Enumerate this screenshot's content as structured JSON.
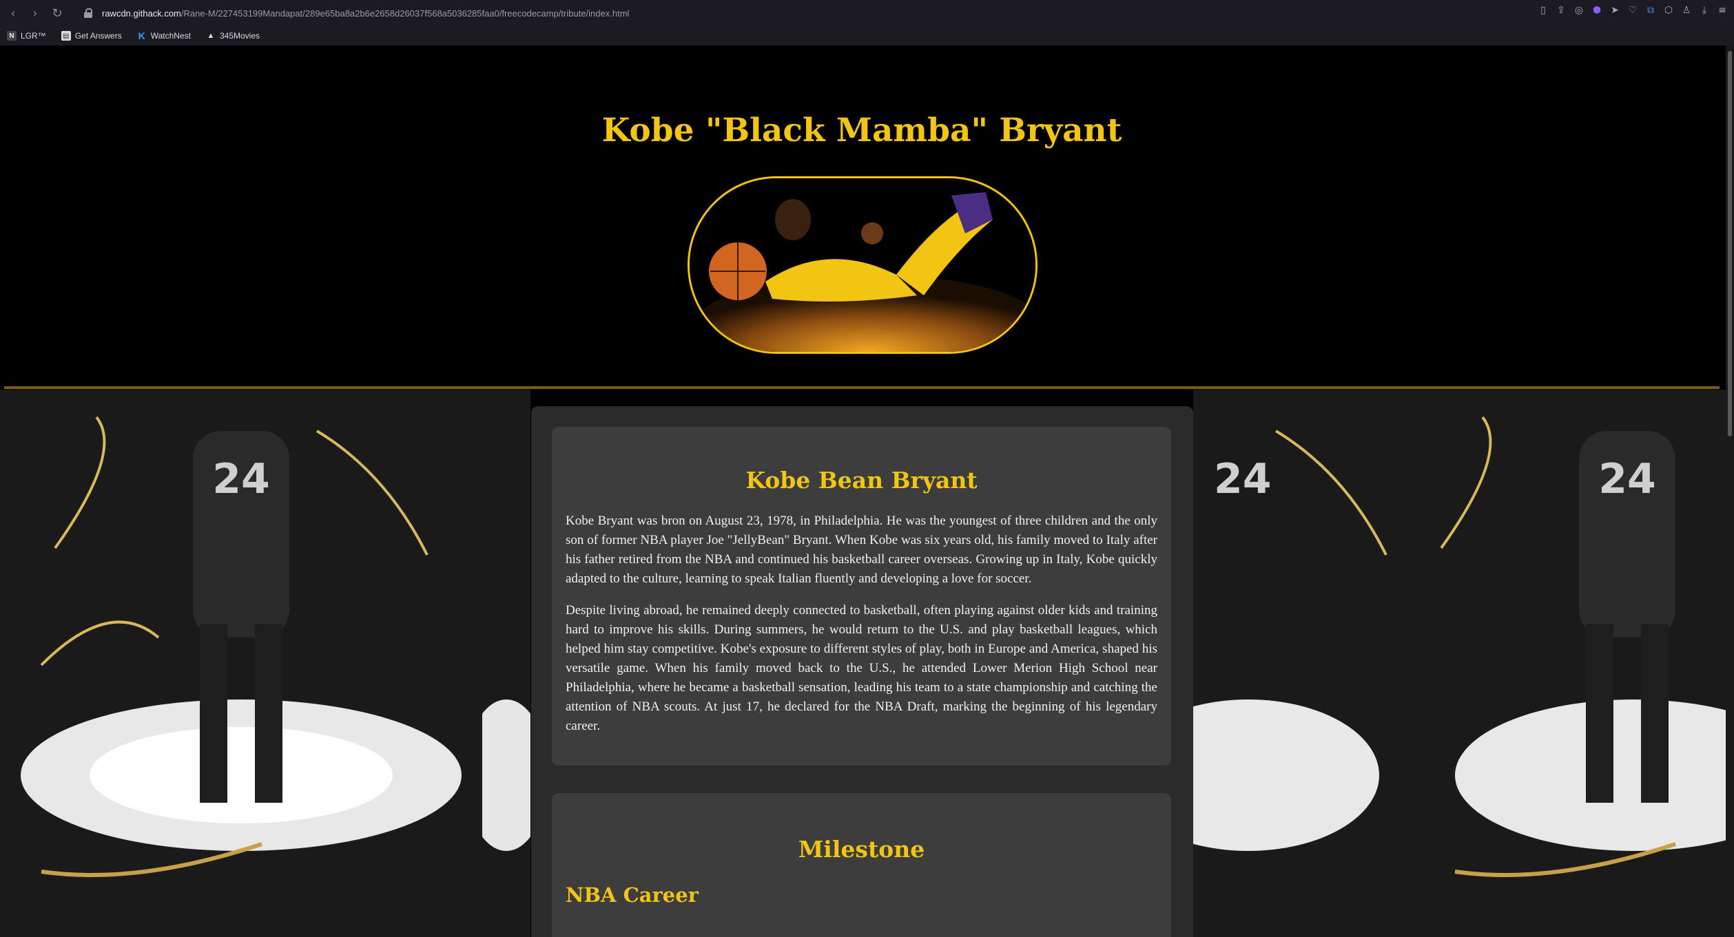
{
  "browser": {
    "url_domain": "rawcdn.githack.com",
    "url_path": "/Rane-M/227453199Mandapat/289e65ba8a2b6e2658d26037f568a5036285faa0/freecodecamp/tribute/index.html",
    "bookmarks": [
      {
        "label": "LGR™",
        "icon": "lgr-icon"
      },
      {
        "label": "Get Answers",
        "icon": "document-icon"
      },
      {
        "label": "WatchNest",
        "icon": "k-logo-icon"
      },
      {
        "label": "345Movies",
        "icon": "triangle-icon"
      }
    ]
  },
  "page": {
    "title": "Kobe \"Black Mamba\" Bryant",
    "bio": {
      "heading": "Kobe Bean Bryant",
      "paragraph_1": "Kobe Bryant was bron on August 23, 1978, in Philadelphia. He was the youngest of three children and the only son of former NBA player Joe \"JellyBean\" Bryant. When Kobe was six years old, his family moved to Italy after his father retired from the NBA and continued his basketball career overseas. Growing up in Italy, Kobe quickly adapted to the culture, learning to speak Italian fluently and developing a love for soccer.",
      "paragraph_2": "Despite living abroad, he remained deeply connected to basketball, often playing against older kids and training hard to improve his skills. During summers, he would return to the U.S. and play basketball leagues, which helped him stay competitive. Kobe's exposure to different styles of play, both in Europe and America, shaped his versatile game. When his family moved back to the U.S., he attended Lower Merion High School near Philadelphia, where he became a basketball sensation, leading his team to a state championship and catching the attention of NBA scouts. At just 17, he declared for the NBA Draft, marking the beginning of his legendary career."
    },
    "milestone": {
      "heading": "Milestone",
      "subheading": "NBA Career"
    }
  },
  "colors": {
    "accent": "#f2c513",
    "header_bg": "#000000",
    "panel_bg": "#2b2b2b",
    "card_bg": "#3d3d3d"
  }
}
